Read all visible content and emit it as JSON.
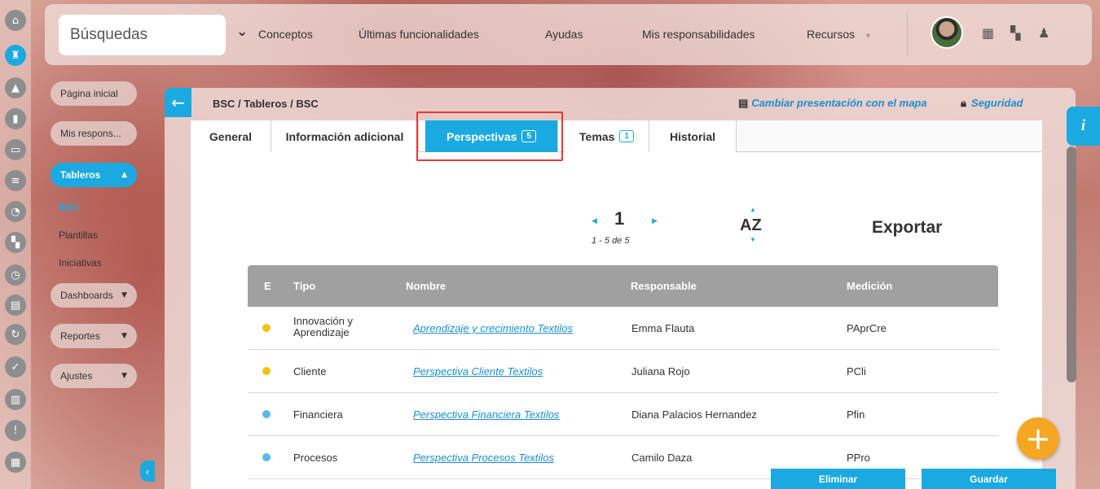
{
  "topbar": {
    "search_label": "Búsquedas",
    "nav": [
      "Conceptos",
      "Últimas funcionalidades",
      "Ayudas",
      "Mis responsabilidades",
      "Recursos"
    ]
  },
  "rail_icons": [
    "home-icon",
    "chess-rook-icon",
    "up-arrow-icon",
    "bar-chart-icon",
    "presentation-icon",
    "align-icon",
    "pie-chart-icon",
    "map-icon",
    "clock-icon",
    "document-icon",
    "refresh-icon",
    "check-circle-icon",
    "briefcase-icon",
    "warning-icon",
    "calendar-icon"
  ],
  "sidebar": {
    "pagina_inicial": "Página inicial",
    "mis_respons": "Mis respons...",
    "tableros": "Tableros",
    "bsc": "BSC",
    "plantillas": "Plantillas",
    "iniciativas": "Iniciativas",
    "dashboards": "Dashboards",
    "reportes": "Reportes",
    "ajustes": "Ajustes"
  },
  "header": {
    "breadcrumb": "BSC / Tableros / BSC",
    "map_link": "Cambiar presentación con el mapa",
    "security_link": "Seguridad"
  },
  "tabs": {
    "general": "General",
    "info": "Información adicional",
    "perspectivas": "Perspectivas",
    "perspectivas_count": "5",
    "temas": "Temas",
    "temas_count": "1",
    "historial": "Historial"
  },
  "pager": {
    "page": "1",
    "range": "1 - 5 de 5"
  },
  "sort_label": "AZ",
  "export_label": "Exportar",
  "table": {
    "headers": {
      "e": "E",
      "tipo": "Tipo",
      "nombre": "Nombre",
      "responsable": "Responsable",
      "medicion": "Medición"
    },
    "rows": [
      {
        "color": "#f5c211",
        "tipo": "Innovación y Aprendizaje",
        "nombre": "Aprendizaje y crecimiento Textilos",
        "responsable": "Emma Flauta",
        "medicion": "PAprCre"
      },
      {
        "color": "#f5c211",
        "tipo": "Cliente",
        "nombre": "Perspectiva Cliente Textilos",
        "responsable": "Juliana Rojo",
        "medicion": "PCli"
      },
      {
        "color": "#5bb8ec",
        "tipo": "Financiera",
        "nombre": "Perspectiva Financiera Textilos",
        "responsable": "Diana Palacios Hernandez",
        "medicion": "Pfin"
      },
      {
        "color": "#5bb8ec",
        "tipo": "Procesos",
        "nombre": "Perspectiva Procesos Textilos",
        "responsable": "Camilo Daza",
        "medicion": "PPro"
      }
    ]
  },
  "actions": {
    "eliminar": "Eliminar",
    "guardar": "Guardar"
  },
  "accent_color": "#1ba9e1"
}
